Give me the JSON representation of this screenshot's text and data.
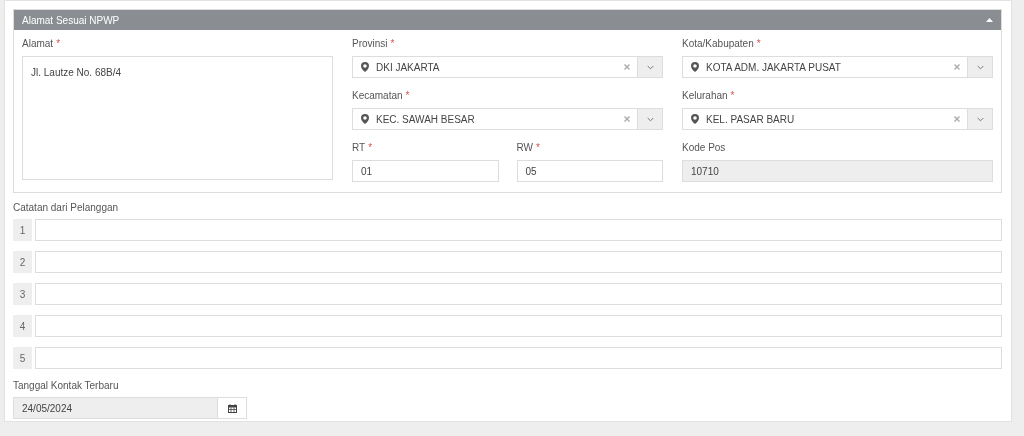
{
  "panel": {
    "title": "Alamat Sesuai NPWP",
    "expanded": true,
    "columns": [
      {
        "fields": [
          {
            "kind": "textarea",
            "label": "Alamat",
            "required_mark": "*",
            "value": "Jl. Lautze No. 68B/4"
          }
        ]
      },
      {
        "fields": [
          {
            "kind": "select",
            "label": "Provinsi",
            "required_mark": "*",
            "value": "DKI JAKARTA"
          },
          {
            "kind": "select",
            "label": "Kecamatan",
            "required_mark": "*",
            "value": "KEC. SAWAH BESAR"
          },
          {
            "kind": "pair",
            "fields": [
              {
                "kind": "text",
                "label": "RT",
                "required_mark": "*",
                "value": "01"
              },
              {
                "kind": "text",
                "label": "RW",
                "required_mark": "*",
                "value": "05"
              }
            ]
          }
        ]
      },
      {
        "fields": [
          {
            "kind": "select",
            "label": "Kota/Kabupaten",
            "required_mark": "*",
            "value": "KOTA ADM. JAKARTA PUSAT"
          },
          {
            "kind": "select",
            "label": "Kelurahan",
            "required_mark": "*",
            "value": "KEL. PASAR BARU"
          },
          {
            "kind": "readonly",
            "label": "Kode Pos",
            "value": "10710"
          }
        ]
      }
    ]
  },
  "notes": {
    "label": "Catatan dari Pelanggan",
    "lines": [
      {
        "number": "1"
      },
      {
        "number": "2"
      },
      {
        "number": "3"
      },
      {
        "number": "4"
      },
      {
        "number": "5"
      }
    ]
  },
  "last_contact": {
    "label": "Tanggal Kontak Terbaru",
    "value": "24/05/2024"
  }
}
